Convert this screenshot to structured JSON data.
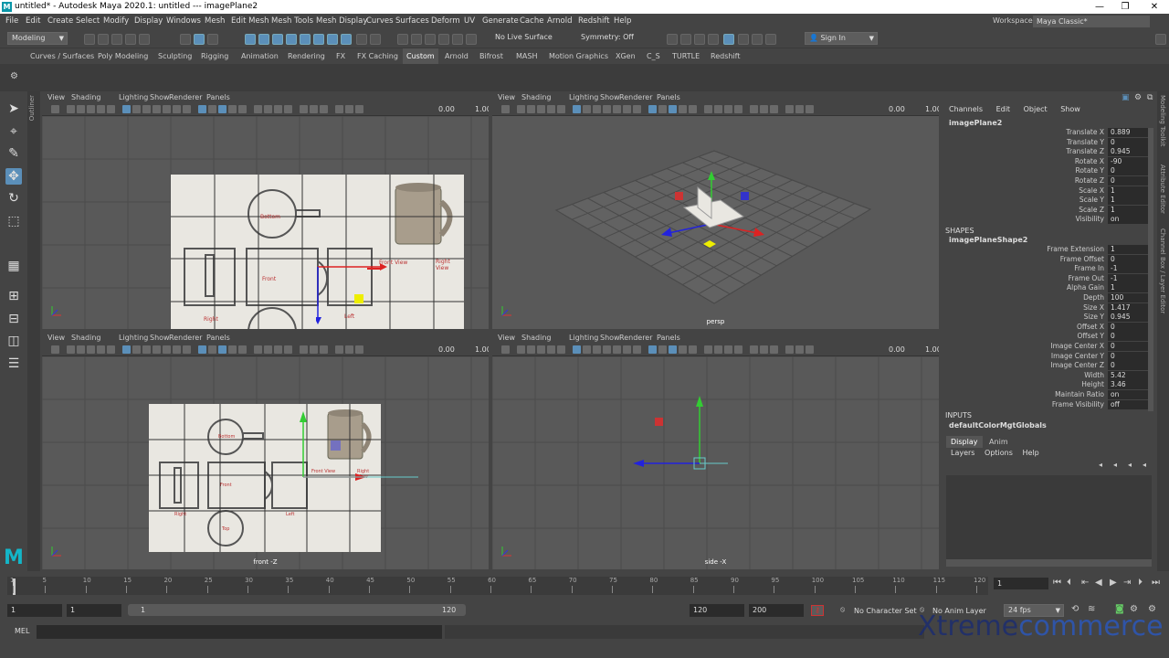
{
  "window": {
    "title": "untitled* - Autodesk Maya 2020.1: untitled   ---   imagePlane2",
    "app_icon": "M",
    "minimize": "—",
    "maximize": "❐",
    "close": "✕"
  },
  "menus": [
    "File",
    "Edit",
    "Create",
    "Select",
    "Modify",
    "Display",
    "Windows",
    "Mesh",
    "Edit Mesh",
    "Mesh Tools",
    "Mesh Display",
    "Curves",
    "Surfaces",
    "Deform",
    "UV",
    "Generate",
    "Cache",
    "Arnold",
    "Redshift",
    "Help"
  ],
  "workspace": {
    "label": "Workspace :",
    "value": "Maya Classic*"
  },
  "statusline": {
    "mode": "Modeling",
    "live_surface": "No Live Surface",
    "symmetry": "Symmetry: Off",
    "sign_in": "Sign In"
  },
  "shelf_tabs": [
    "Curves / Surfaces",
    "Poly Modeling",
    "Sculpting",
    "Rigging",
    "Animation",
    "Rendering",
    "FX",
    "FX Caching",
    "Custom",
    "Arnold",
    "Bifrost",
    "MASH",
    "Motion Graphics",
    "XGen",
    "C_S",
    "TURTLE",
    "Redshift"
  ],
  "shelf_active": "Custom",
  "outliner_label": "Outliner",
  "panel_menu": [
    "View",
    "Shading",
    "Lighting",
    "Show",
    "Renderer",
    "Panels"
  ],
  "panels": [
    {
      "id": "top",
      "camera": "",
      "field1": "0.00",
      "field2": "1.00"
    },
    {
      "id": "persp",
      "camera": "persp",
      "field1": "0.00",
      "field2": "1.00"
    },
    {
      "id": "front",
      "camera": "front -Z",
      "field1": "0.00",
      "field2": "1.00"
    },
    {
      "id": "side",
      "camera": "side -X",
      "field1": "0.00",
      "field2": "1.00"
    }
  ],
  "image_labels": {
    "bottom": "Bottom",
    "top": "Top",
    "front": "Front",
    "right": "Right",
    "left": "Left",
    "front_view": "Front View",
    "right_view": "Right View"
  },
  "channel_box": {
    "menu": [
      "Channels",
      "Edit",
      "Object",
      "Show"
    ],
    "object": "imagePlane2",
    "transform": [
      {
        "label": "Translate X",
        "value": "0.889"
      },
      {
        "label": "Translate Y",
        "value": "0"
      },
      {
        "label": "Translate Z",
        "value": "0.945"
      },
      {
        "label": "Rotate X",
        "value": "-90"
      },
      {
        "label": "Rotate Y",
        "value": "0"
      },
      {
        "label": "Rotate Z",
        "value": "0"
      },
      {
        "label": "Scale X",
        "value": "1"
      },
      {
        "label": "Scale Y",
        "value": "1"
      },
      {
        "label": "Scale Z",
        "value": "1"
      },
      {
        "label": "Visibility",
        "value": "on"
      }
    ],
    "shapes_header": "SHAPES",
    "shape_name": "imagePlaneShape2",
    "shape": [
      {
        "label": "Frame Extension",
        "value": "1"
      },
      {
        "label": "Frame Offset",
        "value": "0"
      },
      {
        "label": "Frame In",
        "value": "-1"
      },
      {
        "label": "Frame Out",
        "value": "-1"
      },
      {
        "label": "Alpha Gain",
        "value": "1"
      },
      {
        "label": "Depth",
        "value": "100"
      },
      {
        "label": "Size X",
        "value": "1.417"
      },
      {
        "label": "Size Y",
        "value": "0.945"
      },
      {
        "label": "Offset X",
        "value": "0"
      },
      {
        "label": "Offset Y",
        "value": "0"
      },
      {
        "label": "Image Center X",
        "value": "0"
      },
      {
        "label": "Image Center Y",
        "value": "0"
      },
      {
        "label": "Image Center Z",
        "value": "0"
      },
      {
        "label": "Width",
        "value": "5.42"
      },
      {
        "label": "Height",
        "value": "3.46"
      },
      {
        "label": "Maintain Ratio",
        "value": "on"
      },
      {
        "label": "Frame Visibility",
        "value": "off"
      }
    ],
    "inputs_header": "INPUTS",
    "input_name": "defaultColorMgtGlobals"
  },
  "layer_editor": {
    "tabs": [
      "Display",
      "Anim"
    ],
    "menu": [
      "Layers",
      "Options",
      "Help"
    ]
  },
  "right_strip": [
    "Modeling Toolkit",
    "Attribute Editor",
    "Channel Box / Layer Editor"
  ],
  "timeline": {
    "ticks": [
      "1",
      "5",
      "10",
      "15",
      "20",
      "25",
      "30",
      "35",
      "40",
      "45",
      "50",
      "55",
      "60",
      "65",
      "70",
      "75",
      "80",
      "85",
      "90",
      "95",
      "100",
      "105",
      "110",
      "115",
      "120"
    ],
    "current_frame": "1"
  },
  "range": {
    "start": "1",
    "inner_start": "1",
    "slider_start": "1",
    "slider_end": "120",
    "end": "120",
    "outer_end": "200",
    "character_set": "No Character Set",
    "anim_layer": "No Anim Layer",
    "fps": "24 fps"
  },
  "cmdline": {
    "label": "MEL"
  },
  "watermark": {
    "a": "Xtreme",
    "b": "commerce"
  }
}
